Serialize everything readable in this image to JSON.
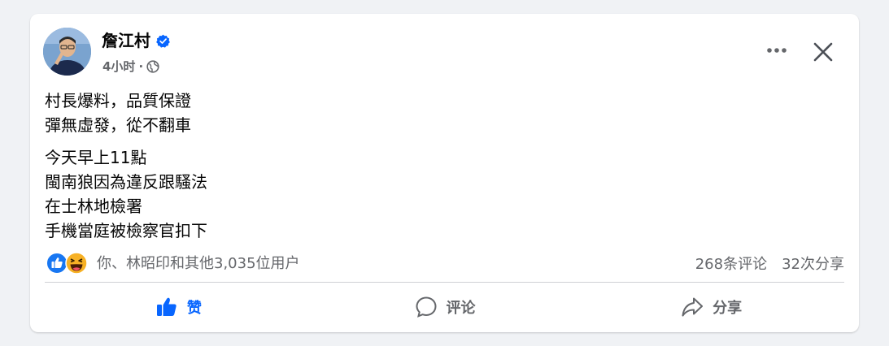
{
  "post": {
    "author_name": "詹江村",
    "timestamp": "4小时",
    "dot": "·",
    "lines_p1": [
      "村長爆料，品質保證",
      "彈無虛發，從不翻車"
    ],
    "lines_p2": [
      "今天早上11點",
      "閩南狼因為違反跟騷法",
      "在士林地檢署",
      "手機當庭被檢察官扣下"
    ]
  },
  "reactions": {
    "summary": "你、林昭印和其他3,035位用户",
    "comments": "268条评论",
    "shares": "32次分享"
  },
  "actions": {
    "like": "赞",
    "comment": "评论",
    "share": "分享"
  },
  "colors": {
    "accent": "#0866ff",
    "secondary_text": "#65676b",
    "verified": "#0866ff"
  }
}
